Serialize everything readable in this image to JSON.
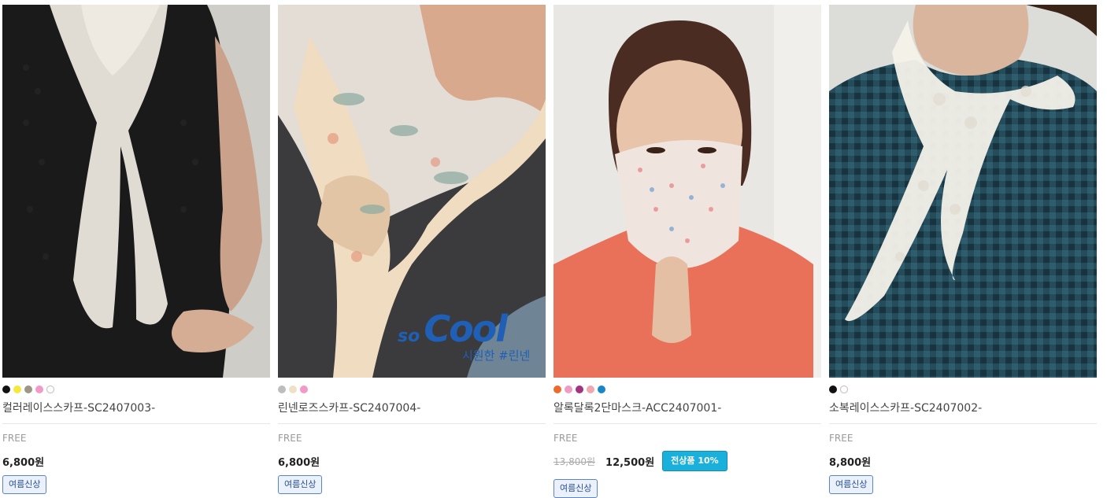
{
  "products": [
    {
      "name": "컬러레이스스카프-SC2407003-",
      "size": "FREE",
      "price": "6,800원",
      "original_price": "",
      "discount_badge": "",
      "tag": "여름신상",
      "colors": [
        "#111111",
        "#f5e73b",
        "#9b9784",
        "#f29ac6",
        "#ffffff"
      ],
      "image_alt": "lace scarf on black knit top"
    },
    {
      "name": "린넨로즈스카프-SC2407004-",
      "size": "FREE",
      "price": "6,800원",
      "original_price": "",
      "discount_badge": "",
      "tag": "여름신상",
      "colors": [
        "#bdbdbd",
        "#efe0c6",
        "#f29ac6"
      ],
      "image_alt": "linen rose scarf",
      "overlay": {
        "brand_small": "so",
        "brand_big": "Cool",
        "caption": "시원한 #린넨"
      }
    },
    {
      "name": "알록달록2단마스크-ACC2407001-",
      "size": "FREE",
      "price": "12,500원",
      "original_price": "13,800원",
      "discount_badge": "전상품 10%",
      "tag": "여름신상",
      "colors": [
        "#ec6a2c",
        "#f29ac6",
        "#a2347f",
        "#f2a6ad",
        "#1a86c8"
      ],
      "image_alt": "floral two-layer face mask"
    },
    {
      "name": "소복레이스스카프-SC2407002-",
      "size": "FREE",
      "price": "8,800원",
      "original_price": "",
      "discount_badge": "",
      "tag": "여름신상",
      "colors": [
        "#111111",
        "#ffffff"
      ],
      "image_alt": "white lace scarf on gingham top"
    }
  ]
}
